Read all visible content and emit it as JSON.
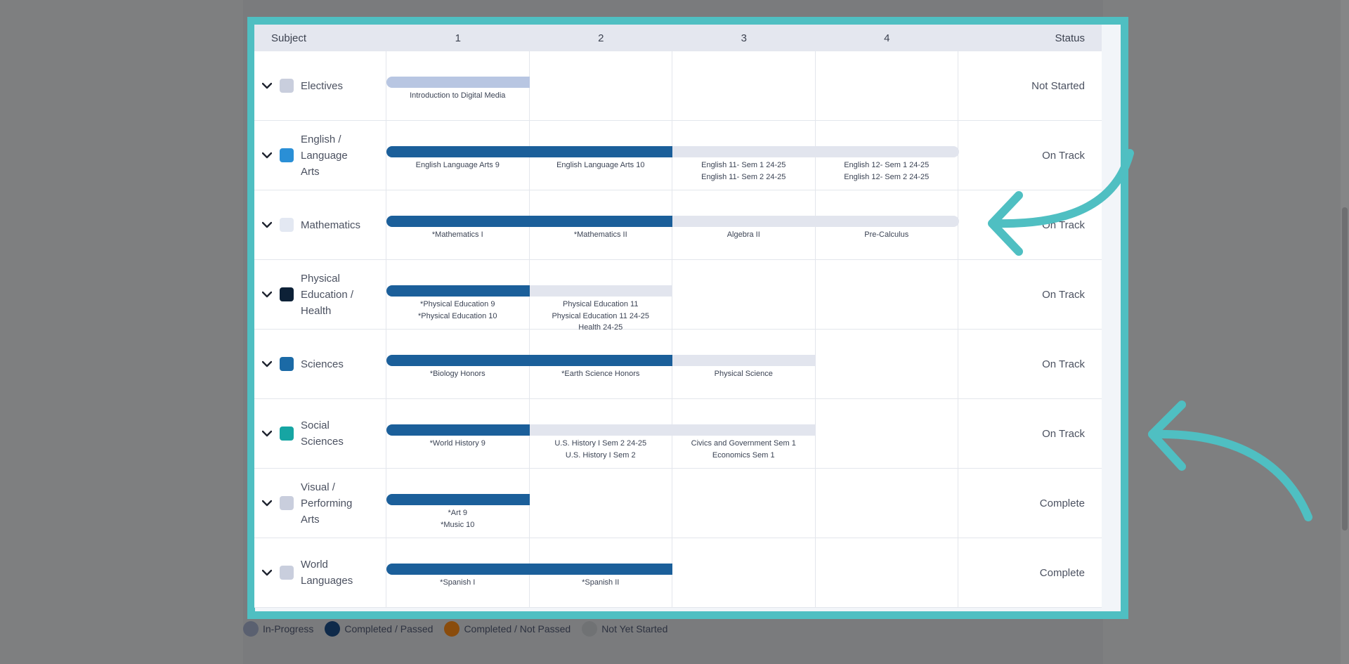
{
  "header": {
    "subject": "Subject",
    "years": [
      "1",
      "2",
      "3",
      "4"
    ],
    "status": "Status"
  },
  "colors": {
    "overlay_bg": "#7e7f80",
    "highlight": "#4fbfc2",
    "completed_bar": "#1b5f9a",
    "planned_bar": "#e2e5ee",
    "elective_bar": "#b8c6e2"
  },
  "rows": [
    {
      "subject": "Electives",
      "swatch": "#c9cedd",
      "status": "Not Started",
      "years": [
        {
          "courses": [
            "Introduction to Digital Media"
          ]
        },
        {
          "courses": []
        },
        {
          "courses": []
        },
        {
          "courses": []
        }
      ]
    },
    {
      "subject": "English / Language Arts",
      "swatch": "#2a8fd6",
      "status": "On Track",
      "years": [
        {
          "courses": [
            "English Language Arts 9"
          ]
        },
        {
          "courses": [
            "English Language Arts 10"
          ]
        },
        {
          "courses": [
            "English 11- Sem 1 24-25",
            "English 11- Sem 2 24-25"
          ]
        },
        {
          "courses": [
            "English 12- Sem 1 24-25",
            "English 12- Sem 2 24-25"
          ]
        }
      ]
    },
    {
      "subject": "Mathematics",
      "swatch": "#e3e8f2",
      "status": "On Track",
      "years": [
        {
          "courses": [
            "*Mathematics I"
          ]
        },
        {
          "courses": [
            "*Mathematics II"
          ]
        },
        {
          "courses": [
            "Algebra II"
          ]
        },
        {
          "courses": [
            "Pre-Calculus"
          ]
        }
      ]
    },
    {
      "subject": "Physical Education / Health",
      "swatch": "#0d2137",
      "status": "On Track",
      "years": [
        {
          "courses": [
            "*Physical Education 9",
            "*Physical Education 10"
          ]
        },
        {
          "courses": [
            "Physical Education 11",
            "Physical Education 11 24-25",
            "Health 24-25"
          ]
        },
        {
          "courses": []
        },
        {
          "courses": []
        }
      ]
    },
    {
      "subject": "Sciences",
      "swatch": "#1b6aa6",
      "status": "On Track",
      "years": [
        {
          "courses": [
            "*Biology Honors"
          ]
        },
        {
          "courses": [
            "*Earth Science Honors"
          ]
        },
        {
          "courses": [
            "Physical Science"
          ]
        },
        {
          "courses": []
        }
      ]
    },
    {
      "subject": "Social Sciences",
      "swatch": "#16a5a3",
      "status": "On Track",
      "years": [
        {
          "courses": [
            "*World History 9"
          ]
        },
        {
          "courses": [
            "U.S. History I Sem 2 24-25",
            "U.S. History I Sem 2"
          ]
        },
        {
          "courses": [
            "Civics and Government Sem 1",
            "Economics Sem 1"
          ]
        },
        {
          "courses": []
        }
      ]
    },
    {
      "subject": "Visual / Performing Arts",
      "swatch": "#c9cedd",
      "status": "Complete",
      "years": [
        {
          "courses": [
            "*Art 9",
            "*Music 10"
          ]
        },
        {
          "courses": []
        },
        {
          "courses": []
        },
        {
          "courses": []
        }
      ]
    },
    {
      "subject": "World Languages",
      "swatch": "#c9cedd",
      "status": "Complete",
      "years": [
        {
          "courses": [
            "*Spanish I"
          ]
        },
        {
          "courses": [
            "*Spanish II"
          ]
        },
        {
          "courses": []
        },
        {
          "courses": []
        }
      ]
    }
  ],
  "legend": [
    {
      "label": "In-Progress",
      "color": "#5a6070"
    },
    {
      "label": "Completed / Passed",
      "color": "#0f2a4a"
    },
    {
      "label": "Completed / Not Passed",
      "color": "#8a4c0c"
    },
    {
      "label": "Not Yet Started",
      "color": "#707274"
    }
  ]
}
